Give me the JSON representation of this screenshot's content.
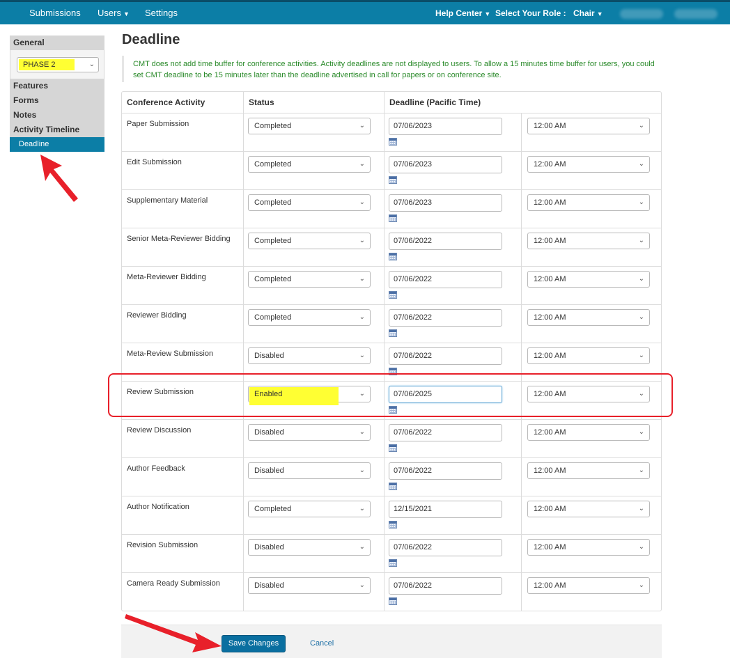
{
  "topbar": {
    "submissions": "Submissions",
    "users": "Users",
    "settings": "Settings",
    "help_center": "Help Center",
    "select_role": "Select Your Role :",
    "role": "Chair",
    "bg_color": "#0c7ea6"
  },
  "sidebar": {
    "general_label": "General",
    "phase_value": "PHASE 2",
    "items": [
      {
        "label": "Features"
      },
      {
        "label": "Forms"
      },
      {
        "label": "Notes"
      },
      {
        "label": "Activity Timeline"
      },
      {
        "label": "Deadline",
        "active": true
      }
    ]
  },
  "page": {
    "title": "Deadline",
    "notice": "CMT does not add time buffer for conference activities. Activity deadlines are not displayed to users. To allow a 15 minutes time buffer for users, you could set CMT deadline to be 15 minutes later than the deadline advertised in call for papers or on conference site."
  },
  "table": {
    "headers": [
      "Conference Activity",
      "Status",
      "Deadline (Pacific Time)",
      ""
    ],
    "rows": [
      {
        "activity": "Paper Submission",
        "status": "Completed",
        "date": "07/06/2023",
        "time": "12:00 AM"
      },
      {
        "activity": "Edit Submission",
        "status": "Completed",
        "date": "07/06/2023",
        "time": "12:00 AM"
      },
      {
        "activity": "Supplementary Material",
        "status": "Completed",
        "date": "07/06/2023",
        "time": "12:00 AM"
      },
      {
        "activity": "Senior Meta-Reviewer Bidding",
        "status": "Completed",
        "date": "07/06/2022",
        "time": "12:00 AM"
      },
      {
        "activity": "Meta-Reviewer Bidding",
        "status": "Completed",
        "date": "07/06/2022",
        "time": "12:00 AM"
      },
      {
        "activity": "Reviewer Bidding",
        "status": "Completed",
        "date": "07/06/2022",
        "time": "12:00 AM"
      },
      {
        "activity": "Meta-Review Submission",
        "status": "Disabled",
        "date": "07/06/2022",
        "time": "12:00 AM"
      },
      {
        "activity": "Review Submission",
        "status": "Enabled",
        "date": "07/06/2025",
        "time": "12:00 AM",
        "highlighted": true
      },
      {
        "activity": "Review Discussion",
        "status": "Disabled",
        "date": "07/06/2022",
        "time": "12:00 AM"
      },
      {
        "activity": "Author Feedback",
        "status": "Disabled",
        "date": "07/06/2022",
        "time": "12:00 AM"
      },
      {
        "activity": "Author Notification",
        "status": "Completed",
        "date": "12/15/2021",
        "time": "12:00 AM"
      },
      {
        "activity": "Revision Submission",
        "status": "Disabled",
        "date": "07/06/2022",
        "time": "12:00 AM"
      },
      {
        "activity": "Camera Ready Submission",
        "status": "Disabled",
        "date": "07/06/2022",
        "time": "12:00 AM"
      }
    ]
  },
  "footer": {
    "save_label": "Save Changes",
    "cancel_label": "Cancel"
  },
  "annotation_colors": {
    "highlight": "#ffff33",
    "arrow": "#e8202a"
  }
}
